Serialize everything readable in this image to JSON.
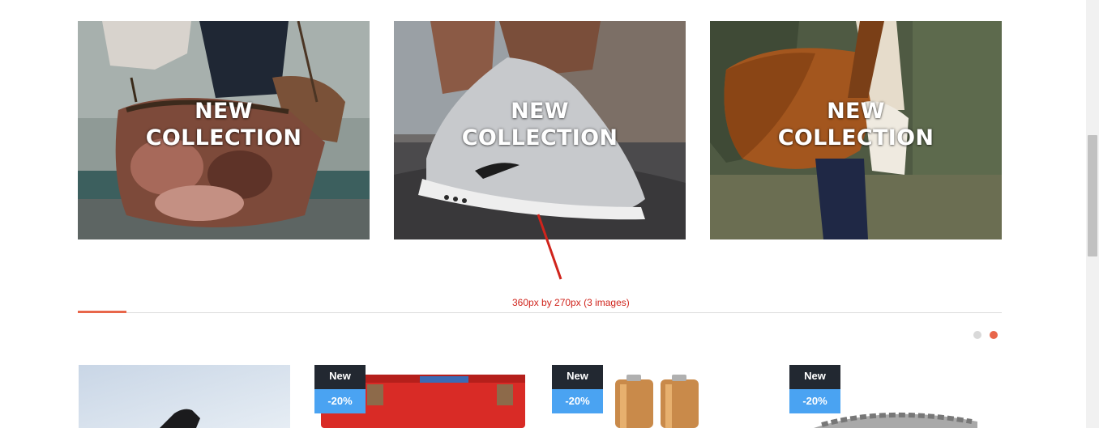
{
  "banners": [
    {
      "title_line1": "NEW",
      "title_line2": "COLLECTION"
    },
    {
      "title_line1": "NEW",
      "title_line2": "COLLECTION"
    },
    {
      "title_line1": "NEW",
      "title_line2": "COLLECTION"
    }
  ],
  "annotation": {
    "text": "360px by 270px (3 images)",
    "color": "#d0241c"
  },
  "carousel": {
    "dots": 2,
    "active_index": 1,
    "accent_color": "#e8664a",
    "inactive_color": "#d9d9d9"
  },
  "products": [
    {
      "badges": []
    },
    {
      "badges": {
        "new": "New",
        "sale": "-20%"
      }
    },
    {
      "badges": {
        "new": "New",
        "sale": "-20%"
      }
    },
    {
      "badges": {
        "new": "New",
        "sale": "-20%"
      }
    }
  ],
  "colors": {
    "badge_new_bg": "#222831",
    "badge_sale_bg": "#4aa3f2"
  }
}
